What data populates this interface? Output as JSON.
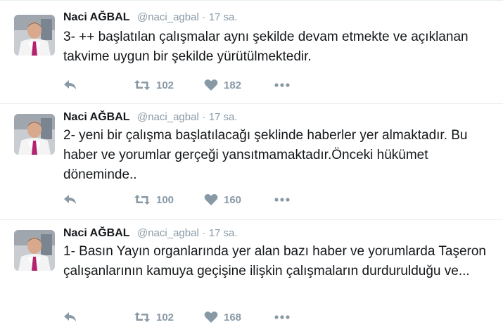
{
  "tweets": [
    {
      "name": "Naci AĞBAL",
      "handle": "@naci_agbal",
      "separator": "·",
      "time": "17 sa.",
      "text": "3- ++ başlatılan çalışmalar aynı şekilde devam etmekte ve açıklanan takvime uygun bir şekilde yürütülmektedir.",
      "retweets": "102",
      "likes": "182"
    },
    {
      "name": "Naci AĞBAL",
      "handle": "@naci_agbal",
      "separator": "·",
      "time": "17 sa.",
      "text": "2- yeni bir çalışma başlatılacağı şeklinde haberler yer almaktadır. Bu haber ve yorumlar gerçeği yansıtmamaktadır.Önceki hükümet döneminde..",
      "retweets": "100",
      "likes": "160"
    },
    {
      "name": "Naci AĞBAL",
      "handle": "@naci_agbal",
      "separator": "·",
      "time": "17 sa.",
      "text": "1- Basın Yayın organlarında yer alan bazı haber ve yorumlarda Taşeron çalışanlarının kamuya geçişine ilişkin çalışmaların durdurulduğu ve...",
      "retweets": "102",
      "likes": "168"
    }
  ],
  "icons": {
    "reply": "reply-icon",
    "retweet": "retweet-icon",
    "like": "heart-icon",
    "more": "more-icon"
  },
  "colors": {
    "icon": "#8899a6",
    "name": "#14171a",
    "meta": "#8899a6",
    "divider": "#e6ecf0"
  }
}
